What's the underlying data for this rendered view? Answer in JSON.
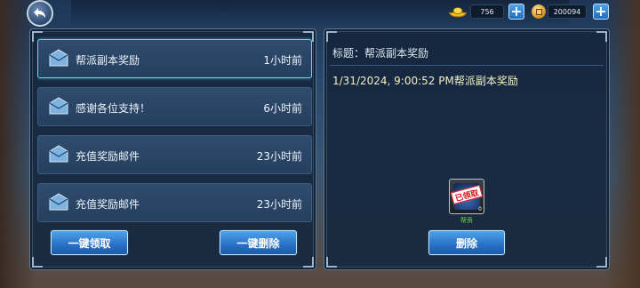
{
  "header": {
    "gold": {
      "icon": "gold-ingot-icon",
      "value": "756"
    },
    "coins": {
      "icon": "copper-coin-icon",
      "value": "200094"
    }
  },
  "mail_list": {
    "items": [
      {
        "title": "帮派副本奖励",
        "time": "1小时前",
        "selected": true
      },
      {
        "title": "感谢各位支持！",
        "time": "6小时前",
        "selected": false
      },
      {
        "title": "充值奖励邮件",
        "time": "23小时前",
        "selected": false
      },
      {
        "title": "充值奖励邮件",
        "time": "23小时前",
        "selected": false
      }
    ],
    "claim_all_label": "一键领取",
    "delete_all_label": "一键删除"
  },
  "detail": {
    "title_line": "标题：帮派副本奖励",
    "body": "1/31/2024, 9:00:52 PM帮派副本奖励",
    "reward": {
      "stamp": "已领取",
      "count": "0",
      "label": "帮贡"
    },
    "delete_label": "删除"
  },
  "colors": {
    "accent_button": "#2a74c9",
    "selected_border": "#6fd3e6",
    "body_text": "#f2efc4",
    "reward_label": "#7ed84a",
    "stamp_red": "#d9141d"
  }
}
